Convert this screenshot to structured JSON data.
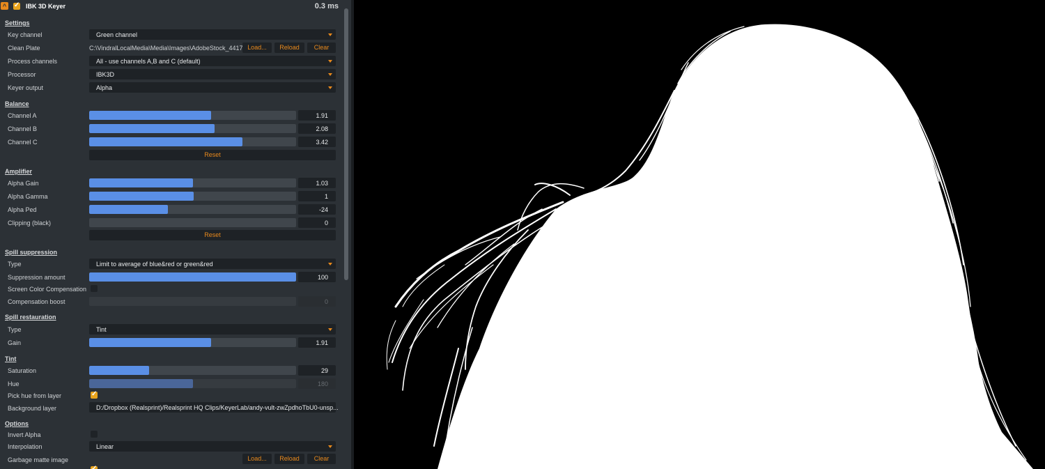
{
  "node": {
    "title": "IBK 3D Keyer",
    "timing": "0.3 ms",
    "enabled": true
  },
  "sections": {
    "settings": "Settings",
    "balance": "Balance",
    "amplifier": "Amplifier",
    "spill_suppression": "Spill suppression",
    "spill_restoration": "Spill restauration",
    "tint": "Tint",
    "options": "Options"
  },
  "settings": {
    "key_channel": {
      "label": "Key channel",
      "value": "Green channel"
    },
    "clean_plate": {
      "label": "Clean Plate",
      "path": "C:\\VindralLocalMedia\\Media\\Images\\AdobeStock_4417...",
      "load": "Load...",
      "reload": "Reload",
      "clear": "Clear"
    },
    "process_channels": {
      "label": "Process channels",
      "value": "All - use channels A,B and C (default)"
    },
    "processor": {
      "label": "Processor",
      "value": "IBK3D"
    },
    "keyer_output": {
      "label": "Keyer output",
      "value": "Alpha"
    }
  },
  "balance": {
    "channel_a": {
      "label": "Channel A",
      "value": "1.91",
      "fill": 0.59
    },
    "channel_b": {
      "label": "Channel B",
      "value": "2.08",
      "fill": 0.605
    },
    "channel_c": {
      "label": "Channel C",
      "value": "3.42",
      "fill": 0.74
    },
    "reset": "Reset"
  },
  "amplifier": {
    "alpha_gain": {
      "label": "Alpha Gain",
      "value": "1.03",
      "fill": 0.5
    },
    "alpha_gamma": {
      "label": "Alpha Gamma",
      "value": "1",
      "fill": 0.505
    },
    "alpha_ped": {
      "label": "Alpha Ped",
      "value": "-24",
      "fill": 0.38
    },
    "clipping_black": {
      "label": "Clipping (black)",
      "value": "0",
      "fill": 0
    },
    "reset": "Reset"
  },
  "spill_suppression": {
    "type": {
      "label": "Type",
      "value": "Limit to average of blue&red or green&red"
    },
    "suppression_amount": {
      "label": "Suppression amount",
      "value": "100",
      "fill": 1.0
    },
    "screen_color_compensation": {
      "label": "Screen Color Compensation",
      "checked": false
    },
    "compensation_boost": {
      "label": "Compensation boost",
      "value": "0",
      "fill": 0
    }
  },
  "spill_restoration": {
    "type": {
      "label": "Type",
      "value": "Tint"
    },
    "gain": {
      "label": "Gain",
      "value": "1.91",
      "fill": 0.59
    }
  },
  "tint": {
    "saturation": {
      "label": "Saturation",
      "value": "29",
      "fill": 0.29
    },
    "hue": {
      "label": "Hue",
      "value": "180",
      "fill": 0.5
    },
    "pick_hue_from_layer": {
      "label": "Pick hue from layer",
      "checked": true
    },
    "background_layer": {
      "label": "Background layer",
      "value": "D:/Dropbox (Realsprint)/Realsprint HQ Clips/KeyerLab/andy-vult-zwZpdhoTbU0-unsp..."
    }
  },
  "options": {
    "invert_alpha": {
      "label": "Invert Alpha",
      "checked": false
    },
    "interpolation": {
      "label": "Interpolation",
      "value": "Linear"
    },
    "garbage_matte_image": {
      "label": "Garbage matte image",
      "load": "Load...",
      "reload": "Reload",
      "clear": "Clear"
    }
  },
  "colors": {
    "accent": "#e8891c",
    "slider_fill": "#5a8fe6",
    "panel_bg": "#2c3136",
    "field_bg": "#1e2226"
  }
}
